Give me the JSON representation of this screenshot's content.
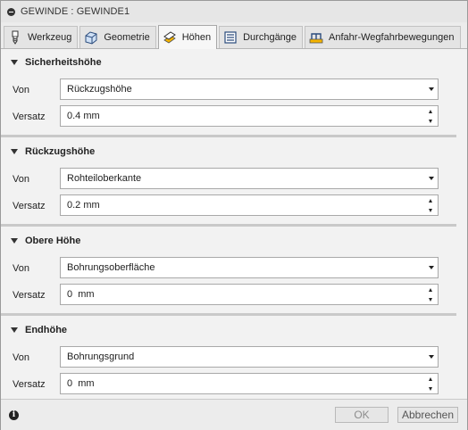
{
  "window": {
    "title": "GEWINDE : GEWINDE1"
  },
  "tabs": [
    {
      "label": "Werkzeug",
      "icon": "tool-icon",
      "active": false
    },
    {
      "label": "Geometrie",
      "icon": "geometry-icon",
      "active": false
    },
    {
      "label": "Höhen",
      "icon": "heights-icon",
      "active": true
    },
    {
      "label": "Durchgänge",
      "icon": "passes-icon",
      "active": false
    },
    {
      "label": "Anfahr-Wegfahrbewegungen",
      "icon": "linking-icon",
      "active": false
    }
  ],
  "sections": [
    {
      "title": "Sicherheitshöhe",
      "von_label": "Von",
      "von_value": "Rückzugshöhe",
      "versatz_label": "Versatz",
      "versatz_value": "0.4 mm"
    },
    {
      "title": "Rückzugshöhe",
      "von_label": "Von",
      "von_value": "Rohteiloberkante",
      "versatz_label": "Versatz",
      "versatz_value": "0.2 mm"
    },
    {
      "title": "Obere Höhe",
      "von_label": "Von",
      "von_value": "Bohrungsoberfläche",
      "versatz_label": "Versatz",
      "versatz_value": "0  mm"
    },
    {
      "title": "Endhöhe",
      "von_label": "Von",
      "von_value": "Bohrungsgrund",
      "versatz_label": "Versatz",
      "versatz_value": "0  mm"
    }
  ],
  "footer": {
    "info_icon": "info-icon",
    "ok_label": "OK",
    "cancel_label": "Abbrechen"
  },
  "colors": {
    "accent": "#f5b400",
    "window_bg": "#ececec",
    "field_border": "#a9a9a9"
  }
}
